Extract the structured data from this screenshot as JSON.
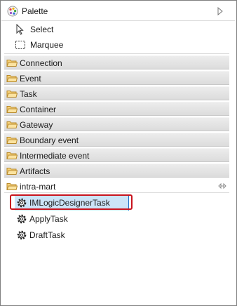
{
  "palette": {
    "title": "Palette",
    "tools": [
      {
        "label": "Select",
        "icon": "arrow-cursor-icon"
      },
      {
        "label": "Marquee",
        "icon": "marquee-icon"
      }
    ],
    "drawers": [
      {
        "label": "Connection",
        "icon": "folder-icon",
        "open": false
      },
      {
        "label": "Event",
        "icon": "folder-icon",
        "open": false
      },
      {
        "label": "Task",
        "icon": "folder-icon",
        "open": false
      },
      {
        "label": "Container",
        "icon": "folder-icon",
        "open": false
      },
      {
        "label": "Gateway",
        "icon": "folder-icon",
        "open": false
      },
      {
        "label": "Boundary event",
        "icon": "folder-icon",
        "open": false
      },
      {
        "label": "Intermediate event",
        "icon": "folder-icon",
        "open": false
      },
      {
        "label": "Artifacts",
        "icon": "folder-icon",
        "open": false
      },
      {
        "label": "intra-mart",
        "icon": "folder-open-icon",
        "open": true
      }
    ],
    "entries": [
      {
        "label": "IMLogicDesignerTask",
        "icon": "gear-icon",
        "selected": true
      },
      {
        "label": "ApplyTask",
        "icon": "gear-icon",
        "selected": false
      },
      {
        "label": "DraftTask",
        "icon": "gear-icon",
        "selected": false
      }
    ],
    "colors": {
      "highlight": "#c8141e",
      "selection": "#cce4f7",
      "folder": "#f2c14e"
    }
  }
}
